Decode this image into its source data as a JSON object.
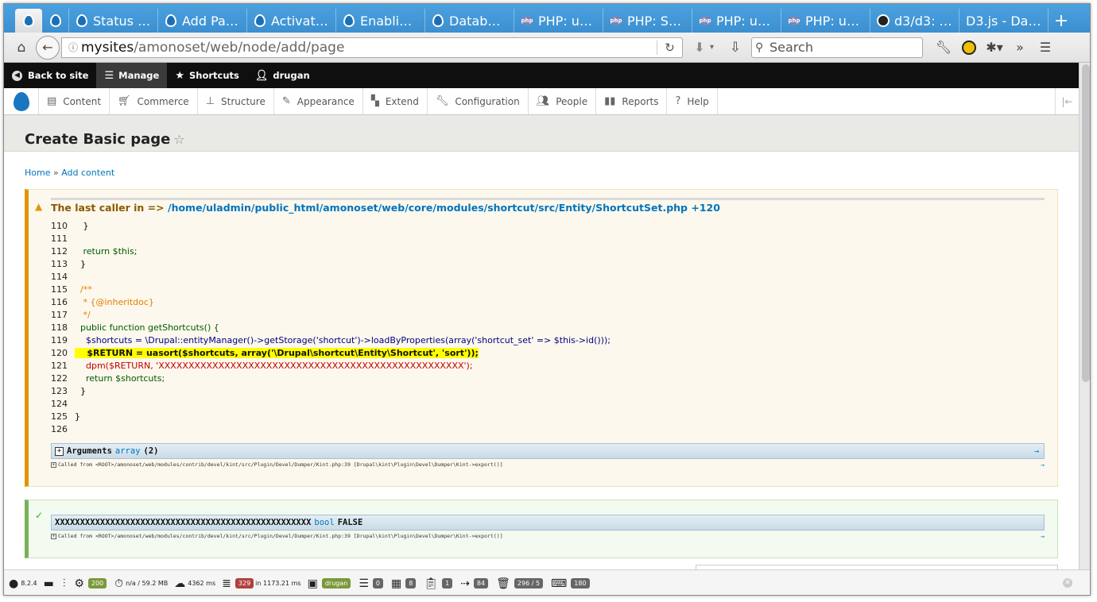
{
  "browser": {
    "tabs": [
      {
        "label": "",
        "icon": "drupal-icon",
        "active": true
      },
      {
        "label": "",
        "icon": "drupal-icon"
      },
      {
        "label": "Status …",
        "icon": "drupal-icon"
      },
      {
        "label": "Add Pa…",
        "icon": "drupal-icon"
      },
      {
        "label": "Activat…",
        "icon": "drupal-icon"
      },
      {
        "label": "Enablin…",
        "icon": "drupal-icon"
      },
      {
        "label": "Databa…",
        "icon": "drupal-icon"
      },
      {
        "label": "PHP: ua…",
        "icon": "php-icon"
      },
      {
        "label": "PHP: S…",
        "icon": "php-icon"
      },
      {
        "label": "PHP: us…",
        "icon": "php-icon"
      },
      {
        "label": "PHP: uk…",
        "icon": "php-icon"
      },
      {
        "label": "d3/d3: …",
        "icon": "github-icon"
      },
      {
        "label": "D3.js - Dat…",
        "icon": "none"
      }
    ],
    "php_icon_text": "php",
    "new_tab_glyph": "+",
    "url_host": "mysites",
    "url_path": "/amonoset/web/node/add/page",
    "search_placeholder": "Search"
  },
  "toolbar": {
    "back_to_site": "Back to site",
    "manage": "Manage",
    "shortcuts": "Shortcuts",
    "user": "drugan"
  },
  "admin_menu": [
    {
      "label": "Content",
      "icon": "content-icon"
    },
    {
      "label": "Commerce",
      "icon": "cart-icon"
    },
    {
      "label": "Structure",
      "icon": "structure-icon"
    },
    {
      "label": "Appearance",
      "icon": "appearance-icon"
    },
    {
      "label": "Extend",
      "icon": "puzzle-icon"
    },
    {
      "label": "Configuration",
      "icon": "wrench-icon"
    },
    {
      "label": "People",
      "icon": "people-icon"
    },
    {
      "label": "Reports",
      "icon": "reports-icon"
    },
    {
      "label": "Help",
      "icon": "help-icon"
    }
  ],
  "page": {
    "title": "Create Basic page",
    "breadcrumb_home": "Home",
    "breadcrumb_sep": " » ",
    "breadcrumb_add": "Add content"
  },
  "warning": {
    "caller_prefix": "The last caller in => ",
    "caller_path": "/home/uladmin/public_html/amonoset/web/core/modules/shortcut/src/Entity/ShortcutSet.php +120",
    "kint_label": "Arguments",
    "kint_type": "array",
    "kint_value": "(2)",
    "called_from": "Called from <ROOT>/amonoset/web/modules/contrib/devel/kint/src/Plugin/Devel/Dumper/Kint.php:39 [Drupal\\kint\\Plugin\\Devel\\Dumper\\Kint->export()]"
  },
  "code_lines": [
    {
      "num": "110",
      "text": "   }"
    },
    {
      "num": "111",
      "text": ""
    },
    {
      "num": "112",
      "text": "   return $this;"
    },
    {
      "num": "113",
      "text": "  }"
    },
    {
      "num": "114",
      "text": ""
    },
    {
      "num": "115",
      "text": "  /**"
    },
    {
      "num": "116",
      "text": "   * {@inheritdoc}"
    },
    {
      "num": "117",
      "text": "   */"
    },
    {
      "num": "118",
      "text": "  public function getShortcuts() {"
    },
    {
      "num": "119",
      "text": "    $shortcuts = \\Drupal::entityManager()->getStorage('shortcut')->loadByProperties(array('shortcut_set' => $this->id()));"
    },
    {
      "num": "120",
      "text": "    $RETURN = uasort($shortcuts, array('\\Drupal\\shortcut\\Entity\\Shortcut', 'sort'));"
    },
    {
      "num": "121",
      "text": "    dpm($RETURN, 'XXXXXXXXXXXXXXXXXXXXXXXXXXXXXXXXXXXXXXXXXXXXXXXXXXX');"
    },
    {
      "num": "122",
      "text": "    return $shortcuts;"
    },
    {
      "num": "123",
      "text": "  }"
    },
    {
      "num": "124",
      "text": ""
    },
    {
      "num": "125",
      "text": "}"
    },
    {
      "num": "126",
      "text": ""
    }
  ],
  "status": {
    "value_label": "XXXXXXXXXXXXXXXXXXXXXXXXXXXXXXXXXXXXXXXXXXXXXXXXXXX",
    "value_type": "bool",
    "value": "FALSE",
    "called_from": "Called from <ROOT>/amonoset/web/modules/contrib/devel/kint/src/Plugin/Devel/Dumper/Kint.php:39 [Drupal\\kint\\Plugin\\Devel\\Dumper\\Kint->export()]"
  },
  "profiler": {
    "drupal_version": "8.2.4",
    "status_code": "200",
    "memory": "n/a / 59.2 MB",
    "time": "4362 ms",
    "db_queries": "329",
    "db_time": "in 1173.21 ms",
    "user": "drugan",
    "forms": "0",
    "blocks": "8",
    "views": "1",
    "routing": "84",
    "assets": "296 / 5",
    "theme": "180"
  },
  "colors": {
    "tab_strip": "#3d8fd0",
    "drupal_toolbar": "#0f0f0f",
    "link": "#0074bd",
    "warning_border": "#e09600",
    "status_border": "#77b259",
    "highlight": "#ffff00"
  }
}
